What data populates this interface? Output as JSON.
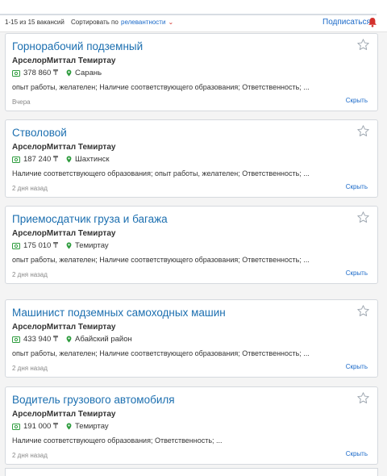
{
  "header": {
    "results_count": "1-15 из 15 вакансий",
    "sort_label": "Сортировать по",
    "sort_value": "релевантности",
    "subscribe_label": "Подписаться"
  },
  "colors": {
    "link": "#1c6fb0",
    "accent": "#d3312c",
    "money": "#2e9c3e"
  },
  "vacancies": [
    {
      "title": "Горнорабочий подземный",
      "company": "АрселорМиттал Темиртау",
      "salary": "378 860 ₸",
      "location": "Сарань",
      "description": "опыт работы, желателен; Наличие соответствующего образования; Ответственность; ...",
      "date": "Вчера",
      "hide_label": "Скрыть"
    },
    {
      "title": "Стволовой",
      "company": "АрселорМиттал Темиртау",
      "salary": "187 240 ₸",
      "location": "Шахтинск",
      "description": "Наличие соответствующего образования; опыт работы, желателен; Ответственность; ...",
      "date": "2 дня назад",
      "hide_label": "Скрыть"
    },
    {
      "title": "Приемосдатчик груза и багажа",
      "company": "АрселорМиттал Темиртау",
      "salary": "175 010 ₸",
      "location": "Темиртау",
      "description": "опыт работы, желателен; Наличие соответствующего образования; Ответственность; ...",
      "date": "2 дня назад",
      "hide_label": "Скрыть"
    },
    {
      "title": "Машинист подземных самоходных машин",
      "company": "АрселорМиттал Темиртау",
      "salary": "433 940 ₸",
      "location": "Абайский район",
      "description": "опыт работы, желателен; Наличие соответствующего образования; Ответственность; ...",
      "date": "2 дня назад",
      "hide_label": "Скрыть"
    },
    {
      "title": "Водитель грузового автомобиля",
      "company": "АрселорМиттал Темиртау",
      "salary": "191 000 ₸",
      "location": "Темиртау",
      "description": "Наличие соответствующего образования; Ответственность; ...",
      "date": "2 дня назад",
      "hide_label": "Скрыть"
    }
  ]
}
